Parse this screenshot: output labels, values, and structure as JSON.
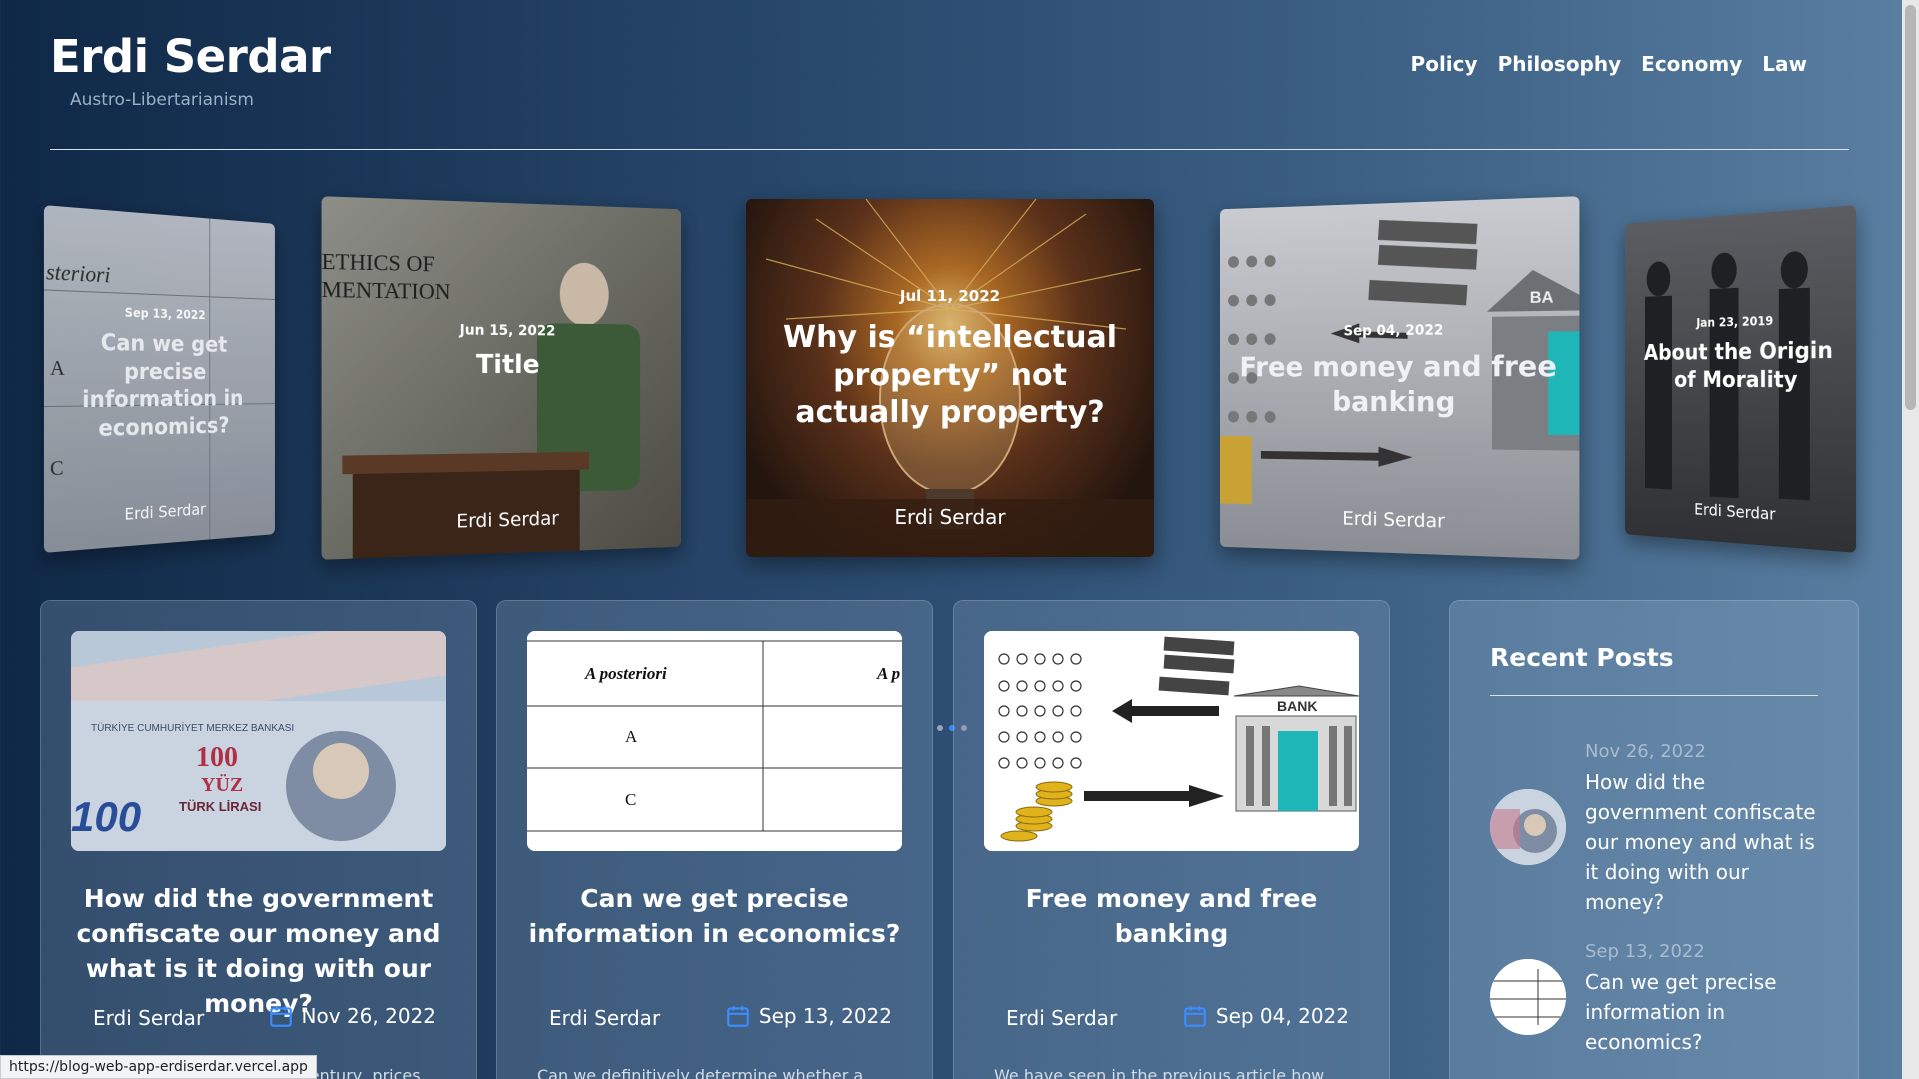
{
  "site": {
    "title": "Erdi Serdar",
    "subtitle": "Austro-Libertarianism"
  },
  "nav": {
    "items": [
      "Policy",
      "Philosophy",
      "Economy",
      "Law"
    ]
  },
  "carousel": {
    "slides": [
      {
        "date": "Sep 13, 2022",
        "title": "Can we get precise information in economics?",
        "author": "Erdi Serdar"
      },
      {
        "date": "Jun 15, 2022",
        "title": "Title",
        "author": "Erdi Serdar"
      },
      {
        "date": "Jul 11, 2022",
        "title": "Why is “intellectual property” not actually property?",
        "author": "Erdi Serdar"
      },
      {
        "date": "Sep 04, 2022",
        "title": "Free money and free banking",
        "author": "Erdi Serdar"
      },
      {
        "date": "Jan 23, 2019",
        "title": "About the Origin of Morality",
        "author": "Erdi Serdar"
      }
    ],
    "active_index": 2
  },
  "posts": [
    {
      "title": "How did the government confiscate our money and what is it doing with our money?",
      "author": "Erdi Serdar",
      "date": "Nov 26, 2022",
      "excerpt": "century, prices"
    },
    {
      "title": "Can we get precise information in economics?",
      "author": "Erdi Serdar",
      "date": "Sep 13, 2022",
      "excerpt": "Can we definitively determine whether a"
    },
    {
      "title": "Free money and free banking",
      "author": "Erdi Serdar",
      "date": "Sep 04, 2022",
      "excerpt": "We have seen in the previous article how"
    }
  ],
  "thumb_text": {
    "table_head_left": "A posteriori",
    "table_head_right": "A p",
    "row1": "A",
    "row2": "C",
    "bank": "BANK",
    "banknote_top": "TÜRKİYE CUMHURİYET MERKEZ BANKASI",
    "banknote_value": "100",
    "banknote_yuz": "YÜZ",
    "banknote_lira": "TÜRK LİRASI"
  },
  "slide_text": {
    "s1_table": "steriori",
    "s1_a": "A",
    "s1_c": "C",
    "s2_line1": "ETHICS OF",
    "s2_line2": "MENTATION",
    "s4_bank": "BA"
  },
  "recent": {
    "title": "Recent Posts",
    "items": [
      {
        "date": "Nov 26, 2022",
        "text": "How did the government confiscate our money and what is it doing with our money?"
      },
      {
        "date": "Sep 13, 2022",
        "text": "Can we get precise information in economics?"
      }
    ]
  },
  "status": {
    "url": "https://blog-web-app-erdiserdar.vercel.app"
  },
  "colors": {
    "accent_dot": "#2f8cff",
    "calendar_icon": "#3b8cff"
  }
}
